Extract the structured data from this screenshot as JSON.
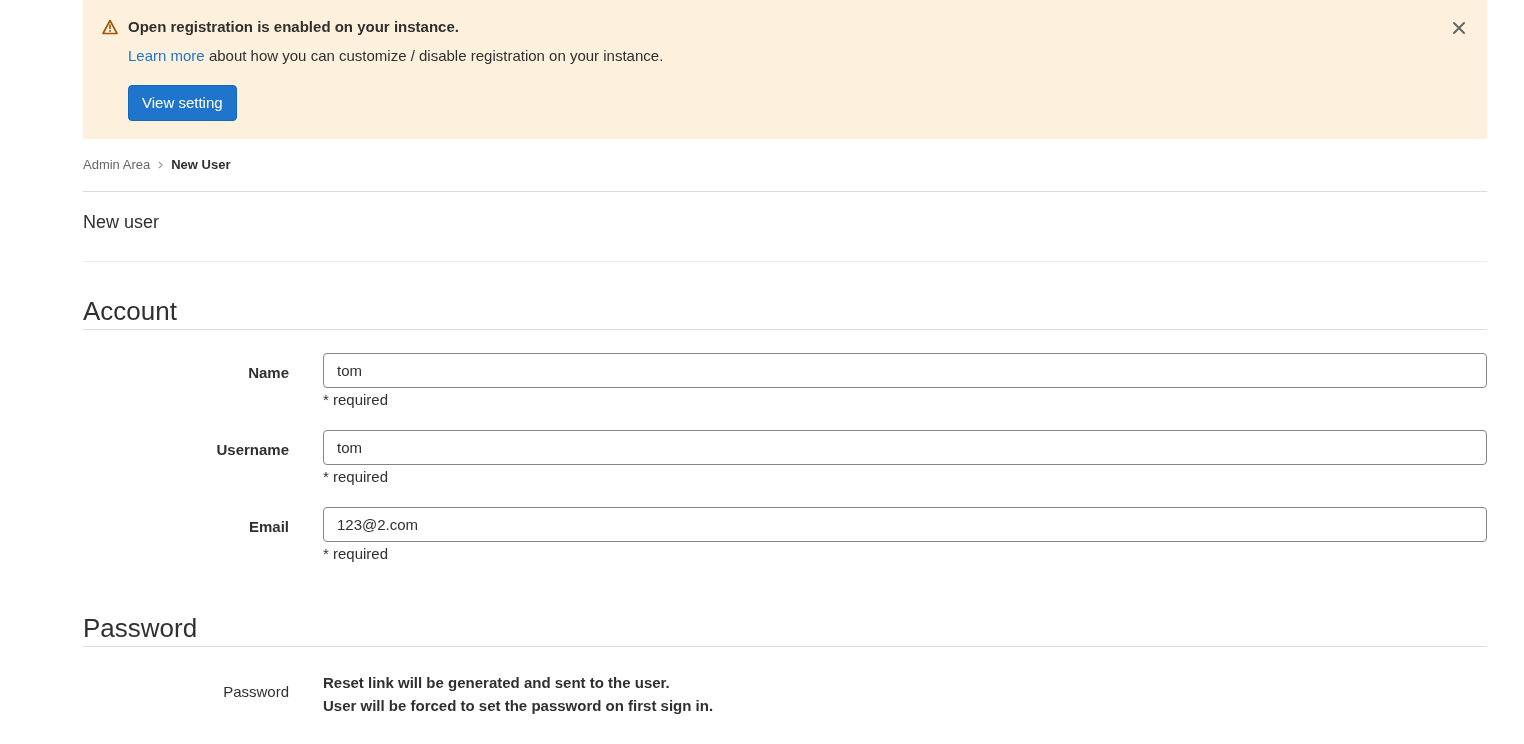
{
  "alert": {
    "title": "Open registration is enabled on your instance.",
    "link": "Learn more",
    "message": " about how you can customize / disable registration on your instance.",
    "button": "View setting"
  },
  "breadcrumb": [
    {
      "label": "Admin Area",
      "selected": false
    },
    {
      "label": "New User",
      "selected": true
    }
  ],
  "page_title": "New user",
  "sections": [
    {
      "heading": "Account",
      "fields": [
        {
          "kind": "input",
          "label": "Name",
          "value": "tom",
          "hint": "* required"
        },
        {
          "kind": "input",
          "label": "Username",
          "value": "tom",
          "hint": "* required"
        },
        {
          "kind": "input",
          "label": "Email",
          "value": "123@2.com",
          "hint": "* required"
        }
      ]
    },
    {
      "heading": "Password",
      "fields": [
        {
          "kind": "text",
          "label": "Password",
          "lines": [
            "Reset link will be generated and sent to the user.",
            "User will be forced to set the password on first sign in."
          ]
        }
      ]
    }
  ]
}
